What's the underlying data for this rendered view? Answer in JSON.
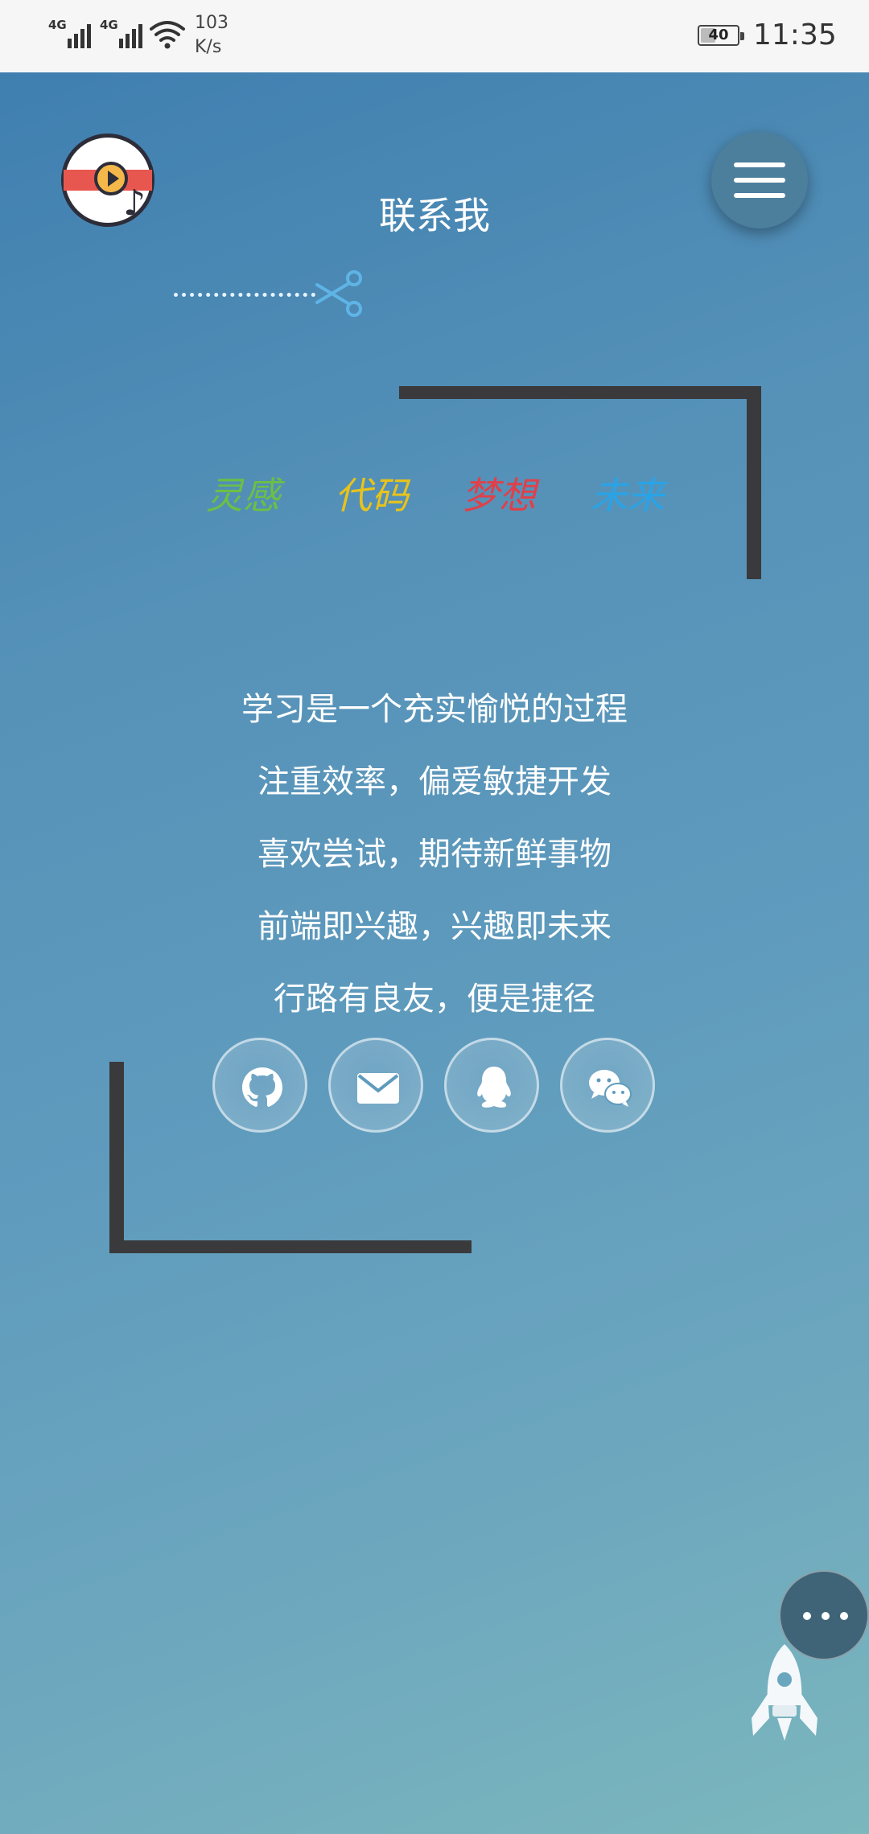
{
  "status_bar": {
    "signal1_label": "4G",
    "signal2_label": "4G",
    "network_speed_value": "103",
    "network_speed_unit": "K/s",
    "battery_level": "40",
    "time": "11:35"
  },
  "header": {
    "title": "联系我"
  },
  "keywords": [
    {
      "text": "灵感",
      "color": "#6cbf46"
    },
    {
      "text": "代码",
      "color": "#e8c31b"
    },
    {
      "text": "梦想",
      "color": "#e0404a"
    },
    {
      "text": "未来",
      "color": "#2aa3e6"
    }
  ],
  "intro_lines": [
    "学习是一个充实愉悦的过程",
    "注重效率，偏爱敏捷开发",
    "喜欢尝试，期待新鲜事物",
    "前端即兴趣，兴趣即未来",
    "行路有良友，便是捷径"
  ],
  "social_icons": [
    "github-icon",
    "mail-icon",
    "qq-icon",
    "wechat-icon"
  ],
  "colors": {
    "accent_frame": "#3a3a3c",
    "background_start": "#3f7fb0",
    "background_end": "#7bb7bd"
  }
}
